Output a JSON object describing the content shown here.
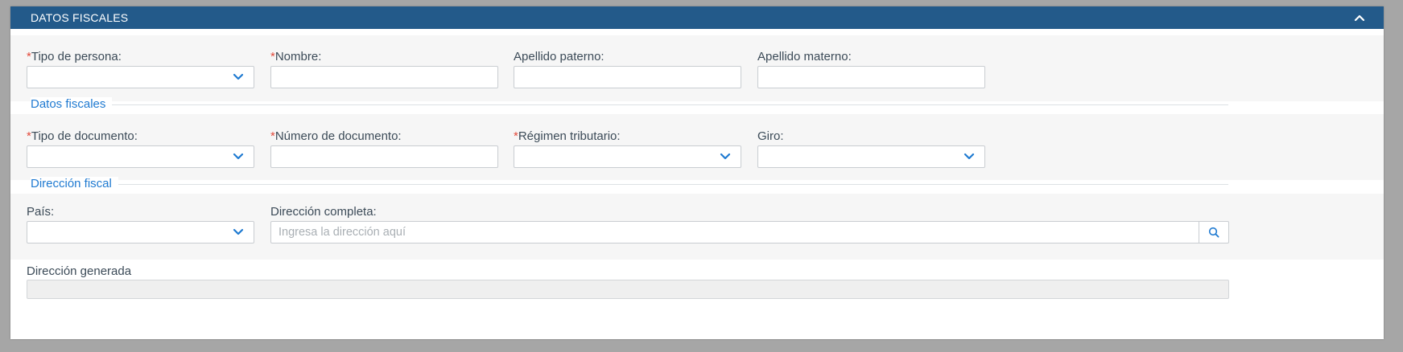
{
  "panel": {
    "title": "DATOS FISCALES",
    "collapse_icon": "chevron-up-icon"
  },
  "required_marker": "*",
  "person": {
    "tipo_persona_label": "Tipo de persona:",
    "nombre_label": "Nombre:",
    "apellido_paterno_label": "Apellido paterno:",
    "apellido_materno_label": "Apellido materno:"
  },
  "sections": {
    "datos_fiscales": "Datos fiscales",
    "direccion_fiscal": "Dirección fiscal"
  },
  "fiscal": {
    "tipo_documento_label": "Tipo de documento:",
    "numero_documento_label": "Número de documento:",
    "regimen_label": "Régimen tributario:",
    "giro_label": "Giro:"
  },
  "address": {
    "pais_label": "País:",
    "direccion_label": "Dirección completa:",
    "direccion_placeholder": "Ingresa la dirección aquí",
    "generada_label": "Dirección generada"
  },
  "colors": {
    "header": "#235a8a",
    "section_title": "#1f7ad1",
    "required": "#e24a3b",
    "icon": "#1f7ad1"
  }
}
